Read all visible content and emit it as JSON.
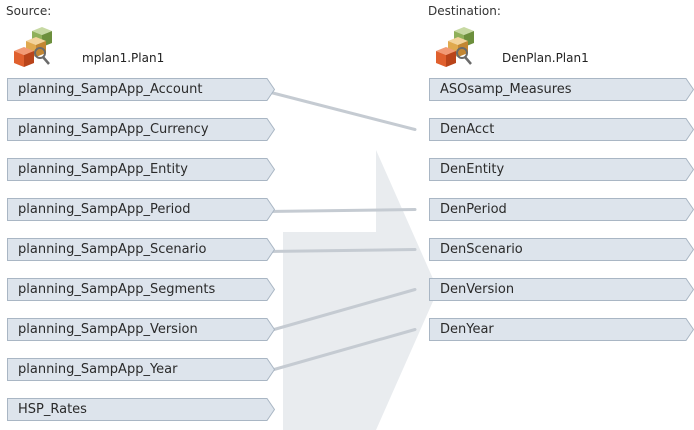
{
  "source": {
    "label": "Source:",
    "plan": "mplan1.Plan1",
    "dimensions": [
      "planning_SampApp_Account",
      "planning_SampApp_Currency",
      "planning_SampApp_Entity",
      "planning_SampApp_Period",
      "planning_SampApp_Scenario",
      "planning_SampApp_Segments",
      "planning_SampApp_Version",
      "planning_SampApp_Year",
      "HSP_Rates"
    ]
  },
  "destination": {
    "label": "Destination:",
    "plan": "DenPlan.Plan1",
    "dimensions": [
      "ASOsamp_Measures",
      "DenAcct",
      "DenEntity",
      "DenPeriod",
      "DenScenario",
      "DenVersion",
      "DenYear"
    ]
  },
  "mappings": [
    {
      "from": "planning_SampApp_Account",
      "to": "DenAcct"
    },
    {
      "from": "planning_SampApp_Period",
      "to": "DenPeriod"
    },
    {
      "from": "planning_SampApp_Scenario",
      "to": "DenScenario"
    },
    {
      "from": "planning_SampApp_Version",
      "to": "DenVersion"
    },
    {
      "from": "planning_SampApp_Year",
      "to": "DenYear"
    }
  ],
  "colors": {
    "tab_fill": "#dde4ec",
    "tab_border": "#a9b6c4",
    "link_line": "#c5cbd2",
    "background_arrow": "#e9ecef"
  }
}
